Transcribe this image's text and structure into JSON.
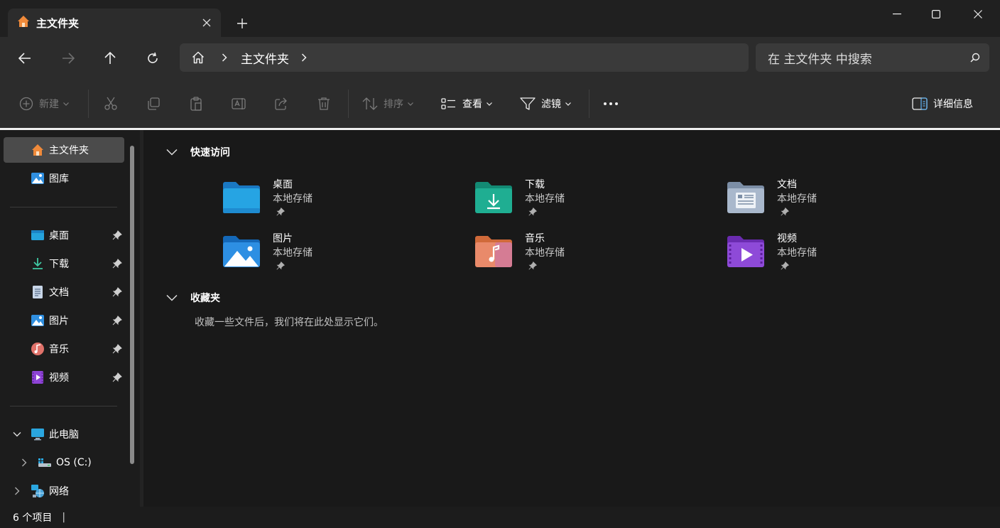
{
  "window": {
    "tab_title": "主文件夹",
    "controls": [
      "minimize-icon",
      "maximize-icon",
      "close-icon"
    ]
  },
  "address": {
    "crumbs": [
      "主文件夹"
    ],
    "search_placeholder": "在 主文件夹 中搜索"
  },
  "toolbar": {
    "new_label": "新建",
    "sort_label": "排序",
    "view_label": "查看",
    "filter_label": "滤镜",
    "details_label": "详细信息",
    "disabled_icons": [
      "cut-icon",
      "copy-icon",
      "paste-icon",
      "rename-icon",
      "share-icon",
      "delete-icon"
    ]
  },
  "sidebar": {
    "top": [
      {
        "label": "主文件夹",
        "icon": "home-icon",
        "selected": true
      },
      {
        "label": "图库",
        "icon": "gallery-icon"
      }
    ],
    "pinned": [
      {
        "label": "桌面",
        "icon": "desktop-icon"
      },
      {
        "label": "下载",
        "icon": "download-icon"
      },
      {
        "label": "文档",
        "icon": "document-icon"
      },
      {
        "label": "图片",
        "icon": "pictures-icon"
      },
      {
        "label": "音乐",
        "icon": "music-icon"
      },
      {
        "label": "视频",
        "icon": "video-icon"
      }
    ],
    "this_pc": "此电脑",
    "drive": "OS (C:)",
    "network": "网络"
  },
  "content": {
    "quick_access_title": "快速访问",
    "quick_access": [
      {
        "name": "桌面",
        "sub": "本地存储",
        "icon": "desktop-folder-icon"
      },
      {
        "name": "下载",
        "sub": "本地存储",
        "icon": "downloads-folder-icon"
      },
      {
        "name": "文档",
        "sub": "本地存储",
        "icon": "documents-folder-icon"
      },
      {
        "name": "图片",
        "sub": "本地存储",
        "icon": "pictures-folder-icon"
      },
      {
        "name": "音乐",
        "sub": "本地存储",
        "icon": "music-folder-icon"
      },
      {
        "name": "视频",
        "sub": "本地存储",
        "icon": "videos-folder-icon"
      }
    ],
    "favorites_title": "收藏夹",
    "favorites_empty": "收藏一些文件后，我们将在此处显示它们。"
  },
  "status": {
    "item_count": "6 个项目",
    "separator": "|"
  },
  "colors": {
    "accent_line": "#f0f0f0",
    "selected_bg": "#4b4b4b",
    "chrome_bg": "#2c2c2c",
    "content_bg": "#191919"
  }
}
